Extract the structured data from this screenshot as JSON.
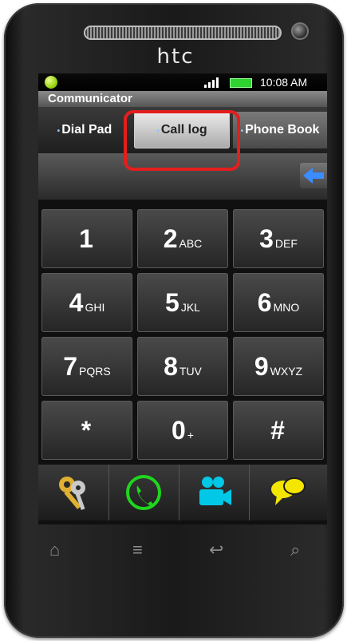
{
  "device": {
    "brand": "htc"
  },
  "status_bar": {
    "time": "10:08 AM"
  },
  "app": {
    "title": "Communicator"
  },
  "tabs": [
    {
      "label": "Dial Pad"
    },
    {
      "label": "Call log"
    },
    {
      "label": "Phone Book"
    }
  ],
  "keypad": [
    {
      "digit": "1",
      "letters": ""
    },
    {
      "digit": "2",
      "letters": "ABC"
    },
    {
      "digit": "3",
      "letters": "DEF"
    },
    {
      "digit": "4",
      "letters": "GHI"
    },
    {
      "digit": "5",
      "letters": "JKL"
    },
    {
      "digit": "6",
      "letters": "MNO"
    },
    {
      "digit": "7",
      "letters": "PQRS"
    },
    {
      "digit": "8",
      "letters": "TUV"
    },
    {
      "digit": "9",
      "letters": "WXYZ"
    },
    {
      "digit": "*",
      "letters": ""
    },
    {
      "digit": "0",
      "letters": "+"
    },
    {
      "digit": "#",
      "letters": ""
    }
  ],
  "actions": [
    {
      "icon": "keys-icon"
    },
    {
      "icon": "phone-call-icon"
    },
    {
      "icon": "video-camera-icon"
    },
    {
      "icon": "chat-bubbles-icon"
    }
  ],
  "nav_bar": [
    {
      "icon": "home-icon"
    },
    {
      "icon": "menu-icon"
    },
    {
      "icon": "back-icon"
    },
    {
      "icon": "search-icon"
    }
  ],
  "colors": {
    "highlight": "#e41e1e",
    "call_green": "#1ed61e",
    "video_cyan": "#00c8e6",
    "chat_yellow": "#f5e600"
  }
}
